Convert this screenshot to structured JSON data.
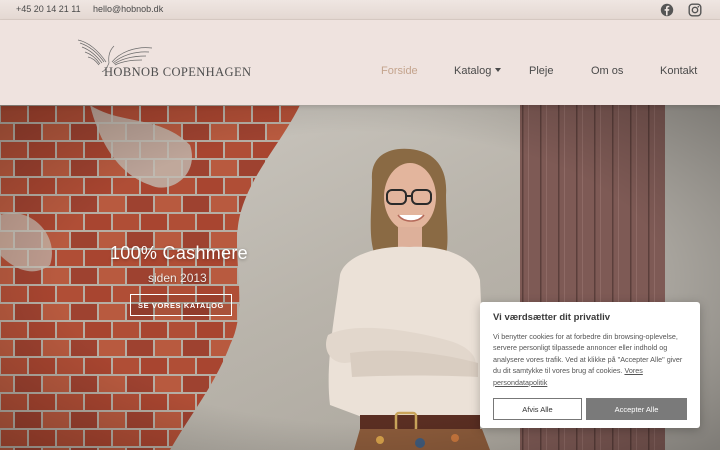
{
  "topbar": {
    "phone": "+45 20 14 21 11",
    "email": "hello@hobnob.dk",
    "social": [
      "facebook-icon",
      "instagram-icon"
    ]
  },
  "logo": {
    "text": "HOBNOB COPENHAGEN"
  },
  "nav": {
    "items": [
      {
        "label": "Forside",
        "active": true
      },
      {
        "label": "Katalog",
        "dropdown": true
      },
      {
        "label": "Pleje"
      },
      {
        "label": "Om os"
      },
      {
        "label": "Kontakt"
      }
    ]
  },
  "hero": {
    "title": "100% Cashmere",
    "subtitle": "siden 2013",
    "cta": "SE VORES KATALOG"
  },
  "cookie": {
    "title": "Vi værdsætter dit privatliv",
    "body": "Vi benytter cookies for at forbedre din browsing-oplevelse, servere personligt tilpassede annoncer eller indhold og analysere vores trafik. Ved at klikke på \"Accepter Alle\" giver du dit samtykke til vores brug af cookies.",
    "link": "Vores persondatapolitik",
    "decline": "Afvis Alle",
    "accept": "Accepter Alle"
  },
  "colors": {
    "header_bg": "#efe3df",
    "active_nav": "#c4a48d",
    "accept_button": "#7a7a7a"
  }
}
